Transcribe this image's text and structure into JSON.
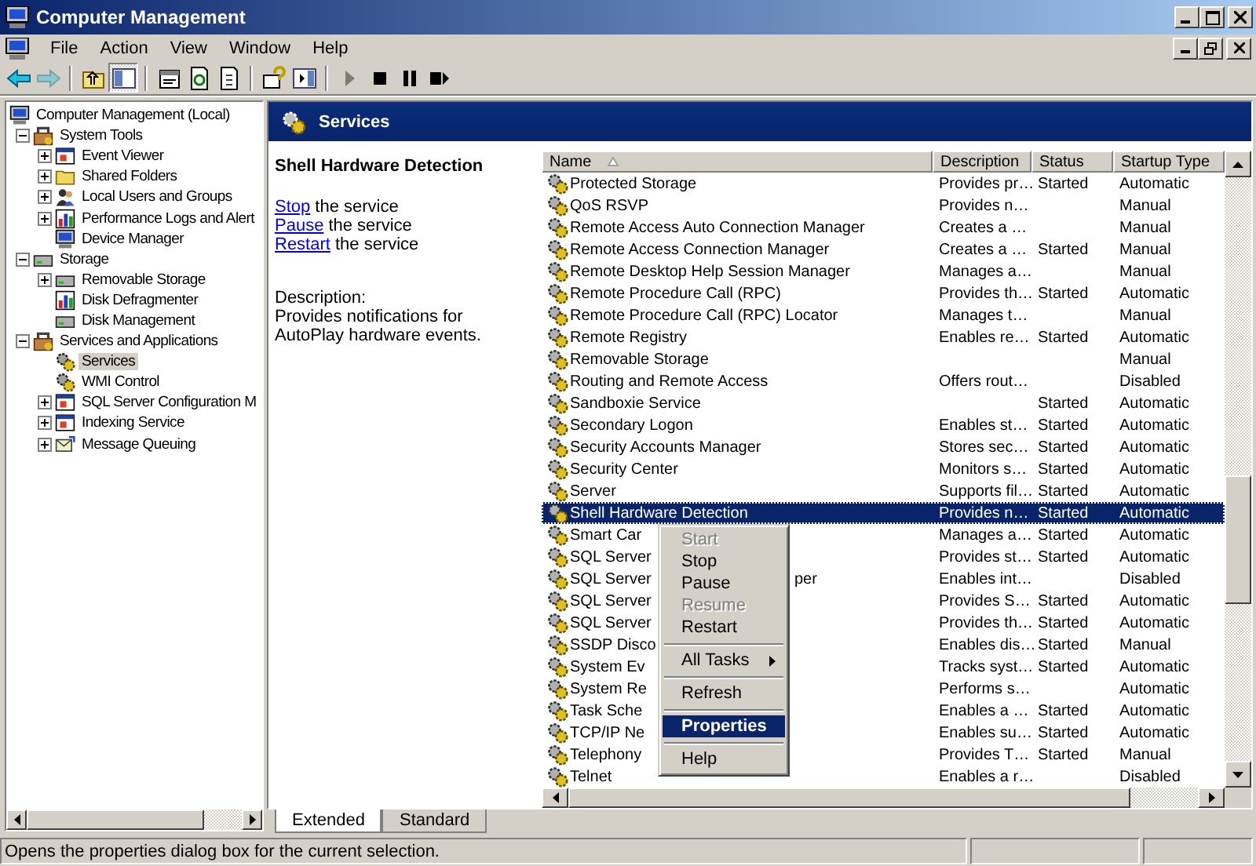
{
  "window": {
    "title": "Computer Management"
  },
  "menu": [
    "File",
    "Action",
    "View",
    "Window",
    "Help"
  ],
  "toolbar": [
    {
      "kind": "back",
      "disabled": false,
      "pressed": false
    },
    {
      "kind": "forward",
      "disabled": true,
      "pressed": false
    },
    {
      "kind": "separator"
    },
    {
      "kind": "up",
      "disabled": false,
      "pressed": false
    },
    {
      "kind": "tree",
      "disabled": false,
      "pressed": true
    },
    {
      "kind": "separator"
    },
    {
      "kind": "properties",
      "disabled": false,
      "pressed": false
    },
    {
      "kind": "refresh",
      "disabled": false,
      "pressed": false
    },
    {
      "kind": "export",
      "disabled": false,
      "pressed": false
    },
    {
      "kind": "separator"
    },
    {
      "kind": "help",
      "disabled": false,
      "pressed": false
    },
    {
      "kind": "actionpane",
      "disabled": false,
      "pressed": false
    },
    {
      "kind": "separator"
    },
    {
      "kind": "play",
      "disabled": true,
      "pressed": false
    },
    {
      "kind": "stop",
      "disabled": false,
      "pressed": false
    },
    {
      "kind": "pause",
      "disabled": false,
      "pressed": false
    },
    {
      "kind": "restart",
      "disabled": false,
      "pressed": false
    }
  ],
  "tree": [
    {
      "label": "Computer Management (Local)",
      "selected": false,
      "children": [
        {
          "label": "System Tools",
          "expanded": true,
          "selected": false,
          "children": [
            {
              "label": "Event Viewer",
              "expanded": false,
              "selected": false
            },
            {
              "label": "Shared Folders",
              "expanded": false,
              "selected": false
            },
            {
              "label": "Local Users and Groups",
              "expanded": false,
              "selected": false
            },
            {
              "label": "Performance Logs and Alert",
              "expanded": false,
              "selected": false
            },
            {
              "label": "Device Manager",
              "selected": false
            }
          ]
        },
        {
          "label": "Storage",
          "expanded": true,
          "selected": false,
          "children": [
            {
              "label": "Removable Storage",
              "expanded": false,
              "selected": false
            },
            {
              "label": "Disk Defragmenter",
              "selected": false
            },
            {
              "label": "Disk Management",
              "selected": false
            }
          ]
        },
        {
          "label": "Services and Applications",
          "expanded": true,
          "selected": false,
          "children": [
            {
              "label": "Services",
              "selected": true
            },
            {
              "label": "WMI Control",
              "selected": false
            },
            {
              "label": "SQL Server Configuration M",
              "expanded": false,
              "selected": false
            },
            {
              "label": "Indexing Service",
              "expanded": false,
              "selected": false
            },
            {
              "label": "Message Queuing",
              "expanded": false,
              "selected": false
            }
          ]
        }
      ]
    }
  ],
  "pane": {
    "title": "Services"
  },
  "action_panel": {
    "service": "Shell Hardware Detection",
    "actions": [
      {
        "link": "Stop",
        "text": "the service"
      },
      {
        "link": "Pause",
        "text": "the service"
      },
      {
        "link": "Restart",
        "text": "the service"
      }
    ],
    "description_label": "Description:",
    "description": "Provides notifications for AutoPlay hardware events."
  },
  "table": {
    "columns": [
      {
        "label": "Name",
        "sorted": true
      },
      {
        "label": "Description",
        "sorted": false
      },
      {
        "label": "Status",
        "sorted": false
      },
      {
        "label": "Startup Type",
        "sorted": false
      }
    ],
    "rows": [
      {
        "name": "Protected Storage",
        "description": "Provides pr…",
        "status": "Started",
        "startup_type": "Automatic",
        "selected": false
      },
      {
        "name": "QoS RSVP",
        "description": "Provides n…",
        "startup_type": "Manual",
        "selected": false
      },
      {
        "name": "Remote Access Auto Connection Manager",
        "description": "Creates a …",
        "startup_type": "Manual",
        "selected": false
      },
      {
        "name": "Remote Access Connection Manager",
        "description": "Creates a …",
        "status": "Started",
        "startup_type": "Manual",
        "selected": false
      },
      {
        "name": "Remote Desktop Help Session Manager",
        "description": "Manages a…",
        "startup_type": "Manual",
        "selected": false
      },
      {
        "name": "Remote Procedure Call (RPC)",
        "description": "Provides th…",
        "status": "Started",
        "startup_type": "Automatic",
        "selected": false
      },
      {
        "name": "Remote Procedure Call (RPC) Locator",
        "description": "Manages t…",
        "startup_type": "Manual",
        "selected": false
      },
      {
        "name": "Remote Registry",
        "description": "Enables re…",
        "status": "Started",
        "startup_type": "Automatic",
        "selected": false
      },
      {
        "name": "Removable Storage",
        "startup_type": "Manual",
        "selected": false
      },
      {
        "name": "Routing and Remote Access",
        "description": "Offers rout…",
        "startup_type": "Disabled",
        "selected": false
      },
      {
        "name": "Sandboxie Service",
        "status": "Started",
        "startup_type": "Automatic",
        "selected": false
      },
      {
        "name": "Secondary Logon",
        "description": "Enables st…",
        "status": "Started",
        "startup_type": "Automatic",
        "selected": false
      },
      {
        "name": "Security Accounts Manager",
        "description": "Stores sec…",
        "status": "Started",
        "startup_type": "Automatic",
        "selected": false
      },
      {
        "name": "Security Center",
        "description": "Monitors s…",
        "status": "Started",
        "startup_type": "Automatic",
        "selected": false
      },
      {
        "name": "Server",
        "description": "Supports fil…",
        "status": "Started",
        "startup_type": "Automatic",
        "selected": false
      },
      {
        "name": "Shell Hardware Detection",
        "description": "Provides n…",
        "status": "Started",
        "startup_type": "Automatic",
        "selected": true
      },
      {
        "name": "Smart Car",
        "description": "Manages a…",
        "status": "Started",
        "startup_type": "Automatic",
        "selected": false
      },
      {
        "name": "SQL Server",
        "description": "Provides st…",
        "status": "Started",
        "startup_type": "Automatic",
        "selected": false
      },
      {
        "name": "SQL Server",
        "name_after_menu": "per",
        "description": "Enables int…",
        "startup_type": "Disabled",
        "selected": false
      },
      {
        "name": "SQL Server",
        "description": "Provides S…",
        "status": "Started",
        "startup_type": "Automatic",
        "selected": false
      },
      {
        "name": "SQL Server",
        "description": "Provides th…",
        "status": "Started",
        "startup_type": "Automatic",
        "selected": false
      },
      {
        "name": "SSDP Disco",
        "description": "Enables dis…",
        "status": "Started",
        "startup_type": "Manual",
        "selected": false
      },
      {
        "name": "System Ev",
        "description": "Tracks syst…",
        "status": "Started",
        "startup_type": "Automatic",
        "selected": false
      },
      {
        "name": "System Re",
        "description": "Performs s…",
        "startup_type": "Automatic",
        "selected": false
      },
      {
        "name": "Task Sche",
        "description": "Enables a …",
        "status": "Started",
        "startup_type": "Automatic",
        "selected": false
      },
      {
        "name": "TCP/IP Ne",
        "description": "Enables su…",
        "status": "Started",
        "startup_type": "Automatic",
        "selected": false
      },
      {
        "name": "Telephony",
        "description": "Provides T…",
        "status": "Started",
        "startup_type": "Manual",
        "selected": false
      },
      {
        "name": "Telnet",
        "description": "Enables a r…",
        "startup_type": "Disabled",
        "selected": false
      }
    ]
  },
  "context_menu": {
    "items": [
      {
        "kind": "item",
        "label": "Start",
        "disabled": true,
        "selected": false,
        "submenu": false
      },
      {
        "kind": "item",
        "label": "Stop",
        "disabled": false,
        "selected": false,
        "submenu": false
      },
      {
        "kind": "item",
        "label": "Pause",
        "disabled": false,
        "selected": false,
        "submenu": false
      },
      {
        "kind": "item",
        "label": "Resume",
        "disabled": true,
        "selected": false,
        "submenu": false
      },
      {
        "kind": "item",
        "label": "Restart",
        "disabled": false,
        "selected": false,
        "submenu": false
      },
      {
        "kind": "separator"
      },
      {
        "kind": "item",
        "label": "All Tasks",
        "disabled": false,
        "selected": false,
        "submenu": true
      },
      {
        "kind": "separator"
      },
      {
        "kind": "item",
        "label": "Refresh",
        "disabled": false,
        "selected": false,
        "submenu": false
      },
      {
        "kind": "separator"
      },
      {
        "kind": "item",
        "label": "Properties",
        "disabled": false,
        "selected": true,
        "submenu": false
      },
      {
        "kind": "separator"
      },
      {
        "kind": "item",
        "label": "Help",
        "disabled": false,
        "selected": false,
        "submenu": false
      }
    ]
  },
  "view_tabs": [
    {
      "label": "Extended",
      "selected": true
    },
    {
      "label": "Standard",
      "selected": false
    }
  ],
  "status_bar": "Opens the properties dialog box for the current selection."
}
